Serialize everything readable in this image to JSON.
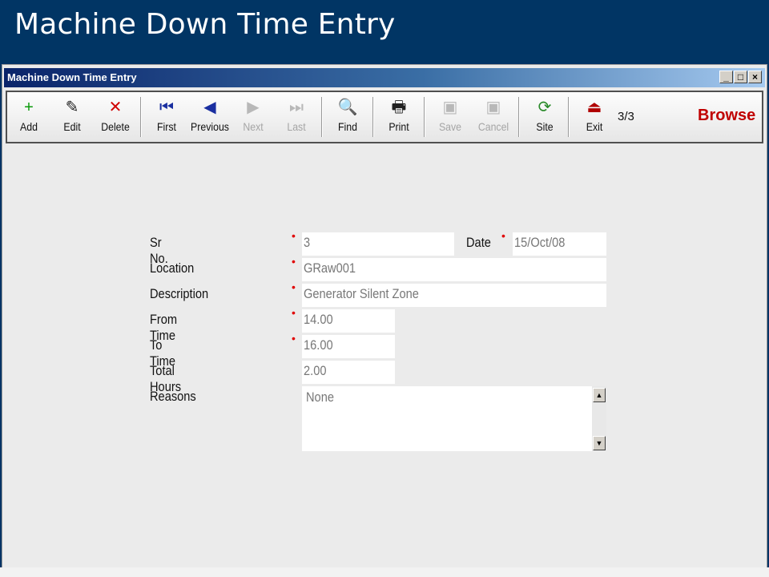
{
  "banner": {
    "title": "Machine Down Time Entry"
  },
  "window": {
    "title": "Machine Down Time Entry",
    "controls": {
      "minimize": "_",
      "maximize": "□",
      "close": "×"
    }
  },
  "toolbar": {
    "buttons": [
      {
        "label": "Add",
        "icon": "plus-icon",
        "glyph": "+",
        "color": "#0a9a0a",
        "enabled": true
      },
      {
        "label": "Edit",
        "icon": "edit-icon",
        "glyph": "✎",
        "color": "#222222",
        "enabled": true
      },
      {
        "label": "Delete",
        "icon": "delete-icon",
        "glyph": "✕",
        "color": "#d00000",
        "enabled": true
      },
      {
        "label": "First",
        "icon": "first-icon",
        "glyph": "⏮",
        "color": "#1a2fa0",
        "enabled": true
      },
      {
        "label": "Previous",
        "icon": "previous-icon",
        "glyph": "◀",
        "color": "#1a2fa0",
        "enabled": true
      },
      {
        "label": "Next",
        "icon": "next-icon",
        "glyph": "▶",
        "color": "#b8b8b8",
        "enabled": false
      },
      {
        "label": "Last",
        "icon": "last-icon",
        "glyph": "⏭",
        "color": "#b8b8b8",
        "enabled": false
      },
      {
        "label": "Find",
        "icon": "binoculars-icon",
        "glyph": "🔍",
        "color": "#222222",
        "enabled": true
      },
      {
        "label": "Print",
        "icon": "printer-icon",
        "glyph": "🖶",
        "color": "#222222",
        "enabled": true
      },
      {
        "label": "Save",
        "icon": "save-icon",
        "glyph": "▣",
        "color": "#b8b8b8",
        "enabled": false
      },
      {
        "label": "Cancel",
        "icon": "cancel-icon",
        "glyph": "▣",
        "color": "#b8b8b8",
        "enabled": false
      },
      {
        "label": "Site",
        "icon": "site-icon",
        "glyph": "⟳",
        "color": "#2a8a2a",
        "enabled": true
      },
      {
        "label": "Exit",
        "icon": "exit-icon",
        "glyph": "⏏",
        "color": "#b00000",
        "enabled": true
      }
    ],
    "record_counter": "3/3",
    "mode": "Browse"
  },
  "form": {
    "sr_no": {
      "label": "Sr No.",
      "value": "3"
    },
    "date": {
      "label": "Date",
      "value": "15/Oct/08"
    },
    "location": {
      "label": "Location",
      "value": "GRaw001"
    },
    "description": {
      "label": "Description",
      "value": "Generator Silent Zone"
    },
    "from_time": {
      "label": "From Time",
      "value": "14.00"
    },
    "to_time": {
      "label": "To Time",
      "value": "16.00"
    },
    "total_hours": {
      "label": "Total Hours",
      "value": "2.00"
    },
    "reasons": {
      "label": "Reasons",
      "value": "None"
    },
    "required_marker": "•"
  }
}
